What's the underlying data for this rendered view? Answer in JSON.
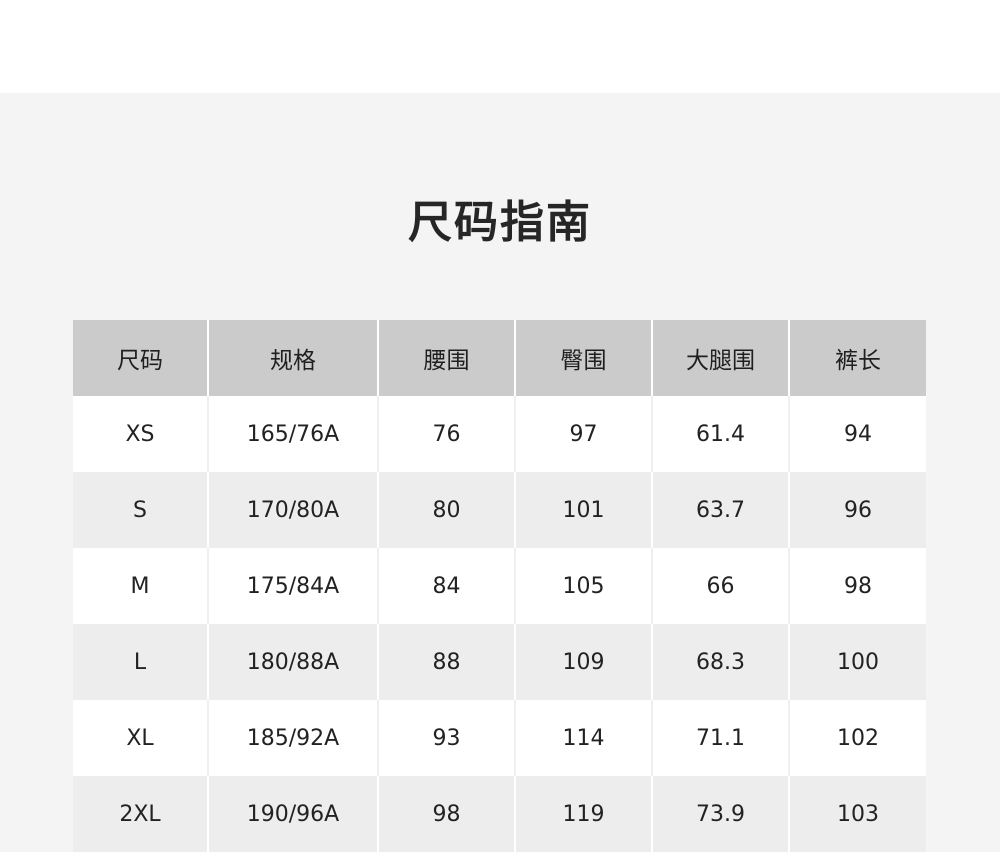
{
  "title": "尺码指南",
  "table": {
    "headers": [
      "尺码",
      "规格",
      "腰围",
      "臀围",
      "大腿围",
      "裤长"
    ],
    "rows": [
      [
        "XS",
        "165/76A",
        "76",
        "97",
        "61.4",
        "94"
      ],
      [
        "S",
        "170/80A",
        "80",
        "101",
        "63.7",
        "96"
      ],
      [
        "M",
        "175/84A",
        "84",
        "105",
        "66",
        "98"
      ],
      [
        "L",
        "180/88A",
        "88",
        "109",
        "68.3",
        "100"
      ],
      [
        "XL",
        "185/92A",
        "93",
        "114",
        "71.1",
        "102"
      ],
      [
        "2XL",
        "190/96A",
        "98",
        "119",
        "73.9",
        "103"
      ]
    ]
  },
  "colors": {
    "panel_background": "#f4f4f4",
    "header_background": "#cbcbcb",
    "row_alt_background": "#ededed",
    "row_background": "#ffffff",
    "text": "#222222"
  }
}
